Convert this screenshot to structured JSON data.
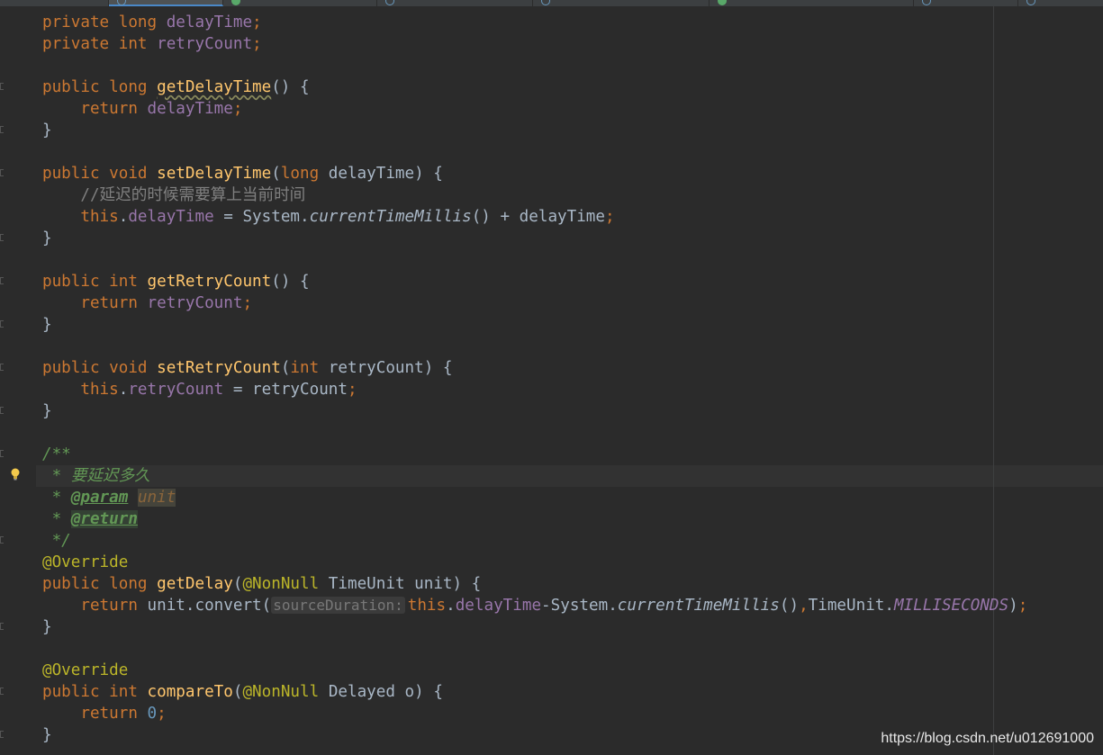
{
  "editor": {
    "theme_bg": "#2b2b2b",
    "caret_line_bg": "#323232",
    "inlay_hint": "sourceDuration:",
    "lines": [
      [
        [
          "kw",
          "private long "
        ],
        [
          "fld",
          "delayTime"
        ],
        [
          "kw",
          ";"
        ]
      ],
      [
        [
          "kw",
          "private int "
        ],
        [
          "fld",
          "retryCount"
        ],
        [
          "kw",
          ";"
        ]
      ],
      [],
      [
        [
          "kw",
          "public long "
        ],
        [
          "fn squig",
          "getDelayTime"
        ],
        [
          "p",
          "() {"
        ]
      ],
      [
        [
          "p",
          "    "
        ],
        [
          "kw",
          "return "
        ],
        [
          "fld",
          "delayTime"
        ],
        [
          "kw",
          ";"
        ]
      ],
      [
        [
          "p",
          "}"
        ]
      ],
      [],
      [
        [
          "kw",
          "public void "
        ],
        [
          "fn",
          "setDelayTime"
        ],
        [
          "p",
          "("
        ],
        [
          "kw",
          "long "
        ],
        [
          "p",
          "delayTime) {"
        ]
      ],
      [
        [
          "p",
          "    "
        ],
        [
          "cm",
          "//延迟的时候需要算上当前时间"
        ]
      ],
      [
        [
          "p",
          "    "
        ],
        [
          "kw",
          "this"
        ],
        [
          "p",
          "."
        ],
        [
          "fld",
          "delayTime"
        ],
        [
          "p",
          " = System."
        ],
        [
          "it",
          "currentTimeMillis"
        ],
        [
          "p",
          "() + delayTime"
        ],
        [
          "kw",
          ";"
        ]
      ],
      [
        [
          "p",
          "}"
        ]
      ],
      [],
      [
        [
          "kw",
          "public int "
        ],
        [
          "fn",
          "getRetryCount"
        ],
        [
          "p",
          "() {"
        ]
      ],
      [
        [
          "p",
          "    "
        ],
        [
          "kw",
          "return "
        ],
        [
          "fld",
          "retryCount"
        ],
        [
          "kw",
          ";"
        ]
      ],
      [
        [
          "p",
          "}"
        ]
      ],
      [],
      [
        [
          "kw",
          "public void "
        ],
        [
          "fn",
          "setRetryCount"
        ],
        [
          "p",
          "("
        ],
        [
          "kw",
          "int "
        ],
        [
          "p",
          "retryCount) {"
        ]
      ],
      [
        [
          "p",
          "    "
        ],
        [
          "kw",
          "this"
        ],
        [
          "p",
          "."
        ],
        [
          "fld",
          "retryCount"
        ],
        [
          "p",
          " = retryCount"
        ],
        [
          "kw",
          ";"
        ]
      ],
      [
        [
          "p",
          "}"
        ]
      ],
      [],
      [
        [
          "dc",
          "/**"
        ]
      ],
      [
        [
          "dc",
          " * 要延迟多久"
        ]
      ],
      [
        [
          "dc",
          " * "
        ],
        [
          "dtag",
          "@param"
        ],
        [
          "dc",
          " "
        ],
        [
          "dval",
          "unit"
        ]
      ],
      [
        [
          "dc",
          " * "
        ],
        [
          "dtag hl",
          "@return"
        ]
      ],
      [
        [
          "dc",
          " */"
        ]
      ],
      [
        [
          "ann",
          "@Override"
        ]
      ],
      [
        [
          "kw",
          "public long "
        ],
        [
          "fn",
          "getDelay"
        ],
        [
          "p",
          "("
        ],
        [
          "ann",
          "@NonNull "
        ],
        [
          "p",
          "TimeUnit unit) {"
        ]
      ],
      [
        [
          "p",
          "    "
        ],
        [
          "kw",
          "return "
        ],
        [
          "p",
          "unit.convert("
        ],
        [
          "hint",
          "sourceDuration:"
        ],
        [
          "kw",
          "this"
        ],
        [
          "p",
          "."
        ],
        [
          "fld",
          "delayTime"
        ],
        [
          "p",
          "-System."
        ],
        [
          "it",
          "currentTimeMillis"
        ],
        [
          "p",
          "()"
        ],
        [
          "kw",
          ","
        ],
        [
          "p",
          "TimeUnit."
        ],
        [
          "stc",
          "MILLISECONDS"
        ],
        [
          "p",
          ")"
        ],
        [
          "kw",
          ";"
        ]
      ],
      [
        [
          "p",
          "}"
        ]
      ],
      [],
      [
        [
          "ann",
          "@Override"
        ]
      ],
      [
        [
          "kw",
          "public int "
        ],
        [
          "fn",
          "compareTo"
        ],
        [
          "p",
          "("
        ],
        [
          "ann",
          "@NonNull "
        ],
        [
          "p",
          "Delayed o) {"
        ]
      ],
      [
        [
          "p",
          "    "
        ],
        [
          "kw",
          "return "
        ],
        [
          "num",
          "0"
        ],
        [
          "kw",
          ";"
        ]
      ],
      [
        [
          "p",
          "}"
        ]
      ]
    ]
  },
  "watermark": "https://blog.csdn.net/u012691000"
}
